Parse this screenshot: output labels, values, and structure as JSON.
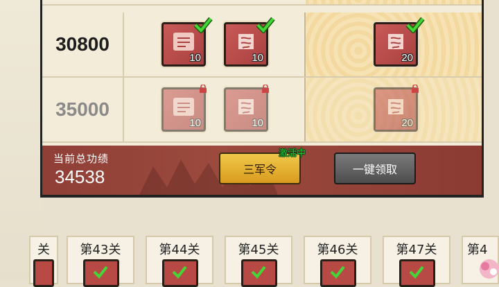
{
  "rows": [
    {
      "score": "30800",
      "status": "claimed",
      "rewards": [
        "10",
        "10"
      ],
      "premium": "20"
    },
    {
      "score": "35000",
      "status": "locked",
      "rewards": [
        "10",
        "10"
      ],
      "premium": "20"
    }
  ],
  "footer": {
    "total_label": "当前总功绩",
    "total_value": "34538",
    "token_button": "三军令",
    "active_tag": "激活中",
    "claim_all_button": "一键领取"
  },
  "stages": [
    "关",
    "第43关",
    "第44关",
    "第45关",
    "第46关",
    "第47关",
    "第4"
  ],
  "icons": {
    "check": "check-icon",
    "lock": "lock-icon",
    "reward": "scroll-icon"
  },
  "colors": {
    "gold_button": "#e0aa2a",
    "active_green": "#27c23a",
    "banner_red": "#9c4a3e"
  }
}
